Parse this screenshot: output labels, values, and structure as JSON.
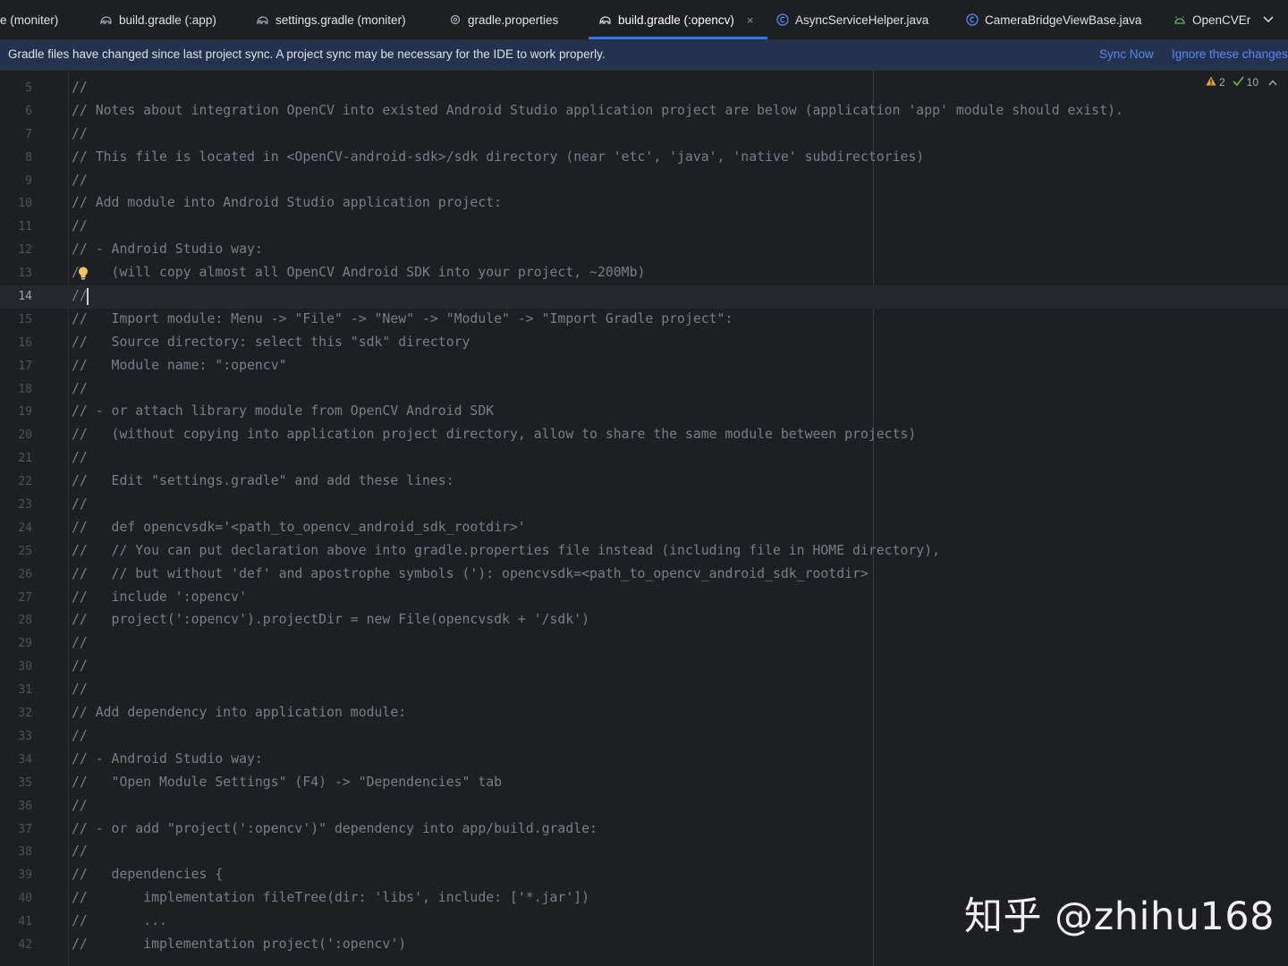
{
  "tabs": [
    {
      "label": "e (moniter)",
      "icon": "gradle-icon",
      "active": false
    },
    {
      "label": "build.gradle (:app)",
      "icon": "gradle-icon",
      "active": false
    },
    {
      "label": "settings.gradle (moniter)",
      "icon": "gradle-icon",
      "active": false
    },
    {
      "label": "gradle.properties",
      "icon": "gear-icon",
      "active": false
    },
    {
      "label": "build.gradle (:opencv)",
      "icon": "gradle-icon",
      "active": true,
      "close": "×"
    },
    {
      "label": "AsyncServiceHelper.java",
      "icon": "java-class-icon",
      "active": false
    },
    {
      "label": "CameraBridgeViewBase.java",
      "icon": "java-class-icon",
      "active": false
    },
    {
      "label": "OpenCVEr",
      "icon": "android-icon",
      "active": false
    }
  ],
  "banner": {
    "message": "Gradle files have changed since last project sync. A project sync may be necessary for the IDE to work properly.",
    "sync_now": "Sync Now",
    "ignore": "Ignore these changes"
  },
  "inspections": {
    "warnings": "2",
    "ok": "10"
  },
  "current_line": 14,
  "lines": [
    {
      "n": "5",
      "text": "//"
    },
    {
      "n": "6",
      "text": "// Notes about integration OpenCV into existed Android Studio application project are below (application 'app' module should exist)."
    },
    {
      "n": "7",
      "text": "//"
    },
    {
      "n": "8",
      "text": "// This file is located in <OpenCV-android-sdk>/sdk directory (near 'etc', 'java', 'native' subdirectories)"
    },
    {
      "n": "9",
      "text": "//"
    },
    {
      "n": "10",
      "text": "// Add module into Android Studio application project:"
    },
    {
      "n": "11",
      "text": "//"
    },
    {
      "n": "12",
      "text": "// - Android Studio way:"
    },
    {
      "n": "13",
      "text": "/    (will copy almost all OpenCV Android SDK into your project, ~200Mb)"
    },
    {
      "n": "14",
      "text": "//"
    },
    {
      "n": "15",
      "text": "//   Import module: Menu -> \"File\" -> \"New\" -> \"Module\" -> \"Import Gradle project\":"
    },
    {
      "n": "16",
      "text": "//   Source directory: select this \"sdk\" directory"
    },
    {
      "n": "17",
      "text": "//   Module name: \":opencv\""
    },
    {
      "n": "18",
      "text": "//"
    },
    {
      "n": "19",
      "text": "// - or attach library module from OpenCV Android SDK"
    },
    {
      "n": "20",
      "text": "//   (without copying into application project directory, allow to share the same module between projects)"
    },
    {
      "n": "21",
      "text": "//"
    },
    {
      "n": "22",
      "text": "//   Edit \"settings.gradle\" and add these lines:"
    },
    {
      "n": "23",
      "text": "//"
    },
    {
      "n": "24",
      "text": "//   def opencvsdk='<path_to_opencv_android_sdk_rootdir>'"
    },
    {
      "n": "25",
      "text": "//   // You can put declaration above into gradle.properties file instead (including file in HOME directory),"
    },
    {
      "n": "26",
      "text": "//   // but without 'def' and apostrophe symbols ('): opencvsdk=<path_to_opencv_android_sdk_rootdir>"
    },
    {
      "n": "27",
      "text": "//   include ':opencv'"
    },
    {
      "n": "28",
      "text": "//   project(':opencv').projectDir = new File(opencvsdk + '/sdk')"
    },
    {
      "n": "29",
      "text": "//"
    },
    {
      "n": "30",
      "text": "//"
    },
    {
      "n": "31",
      "text": "//"
    },
    {
      "n": "32",
      "text": "// Add dependency into application module:"
    },
    {
      "n": "33",
      "text": "//"
    },
    {
      "n": "34",
      "text": "// - Android Studio way:"
    },
    {
      "n": "35",
      "text": "//   \"Open Module Settings\" (F4) -> \"Dependencies\" tab"
    },
    {
      "n": "36",
      "text": "//"
    },
    {
      "n": "37",
      "text": "// - or add \"project(':opencv')\" dependency into app/build.gradle:"
    },
    {
      "n": "38",
      "text": "//"
    },
    {
      "n": "39",
      "text": "//   dependencies {"
    },
    {
      "n": "40",
      "text": "//       implementation fileTree(dir: 'libs', include: ['*.jar'])"
    },
    {
      "n": "41",
      "text": "//       ..."
    },
    {
      "n": "42",
      "text": "//       implementation project(':opencv')"
    }
  ],
  "watermark": "知乎 @zhihu168"
}
